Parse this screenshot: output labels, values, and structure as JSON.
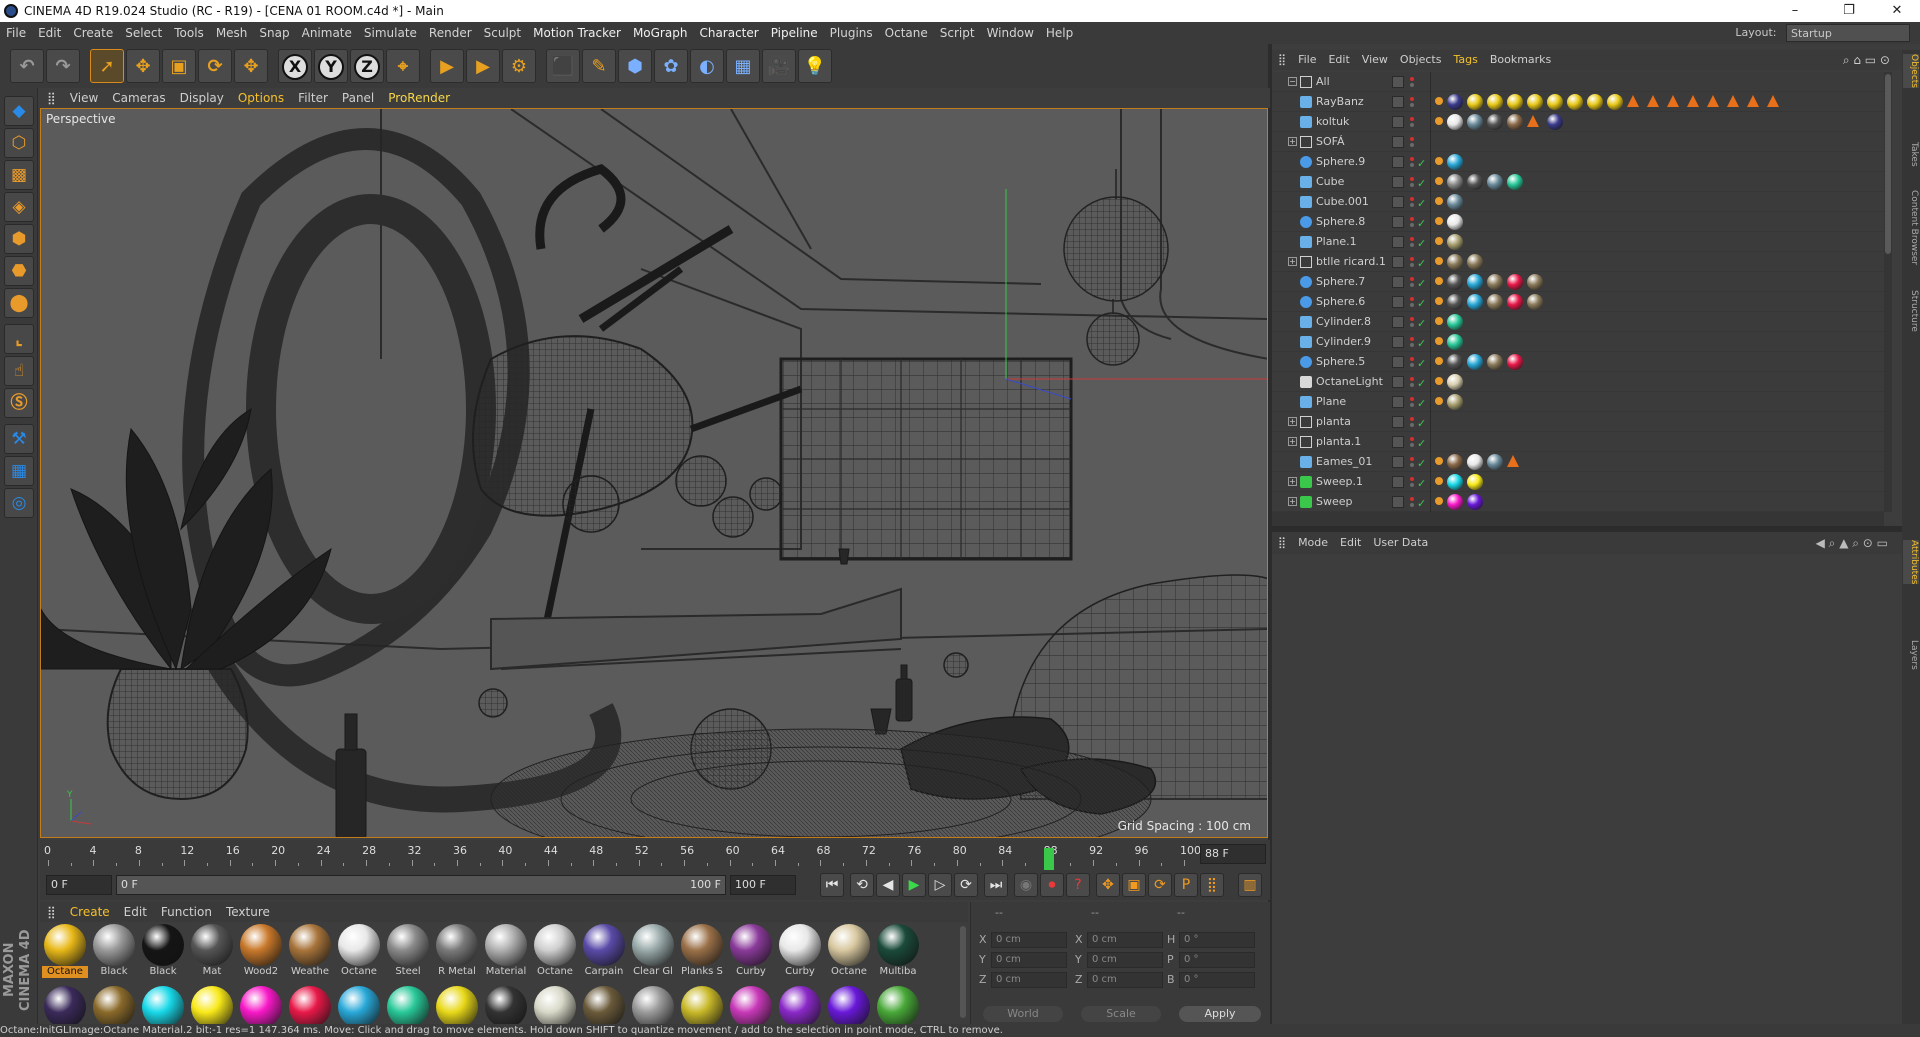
{
  "window": {
    "title": "CINEMA 4D R19.024 Studio (RC - R19) - [CENA 01 ROOM.c4d *] - Main",
    "minimize": "–",
    "restore": "❐",
    "close": "✕"
  },
  "menubar": {
    "items": [
      "File",
      "Edit",
      "Create",
      "Select",
      "Tools",
      "Mesh",
      "Snap",
      "Animate",
      "Simulate",
      "Render",
      "Sculpt",
      "Motion Tracker",
      "MoGraph",
      "Character",
      "Pipeline",
      "Plugins",
      "Octane",
      "Script",
      "Window",
      "Help"
    ],
    "layout_label": "Layout:",
    "layout_value": "Startup"
  },
  "toolbar": {
    "buttons": [
      {
        "name": "undo",
        "glyph": "↶"
      },
      {
        "name": "redo",
        "glyph": "↷"
      },
      {
        "name": "live-select",
        "glyph": "➚"
      },
      {
        "name": "move",
        "glyph": "✥"
      },
      {
        "name": "scale",
        "glyph": "▣"
      },
      {
        "name": "rotate",
        "glyph": "⟳"
      },
      {
        "name": "recent-tool",
        "glyph": "✥"
      },
      {
        "name": "x-axis",
        "glyph": "X"
      },
      {
        "name": "y-axis",
        "glyph": "Y"
      },
      {
        "name": "z-axis",
        "glyph": "Z"
      },
      {
        "name": "coordinate-system",
        "glyph": "⌖"
      },
      {
        "name": "render-view",
        "glyph": "▶"
      },
      {
        "name": "render-picture-viewer",
        "glyph": "▶"
      },
      {
        "name": "edit-render-settings",
        "glyph": "⚙"
      },
      {
        "name": "cube",
        "glyph": "⬛"
      },
      {
        "name": "pen",
        "glyph": "✎"
      },
      {
        "name": "subdivision",
        "glyph": "⬢"
      },
      {
        "name": "cloner",
        "glyph": "✿"
      },
      {
        "name": "deformer",
        "glyph": "◐"
      },
      {
        "name": "floor",
        "glyph": "▦"
      },
      {
        "name": "camera",
        "glyph": "🎥"
      },
      {
        "name": "light",
        "glyph": "💡"
      }
    ]
  },
  "lefttools": {
    "buttons": [
      "make-editable",
      "model-mode",
      "texture-mode",
      "workplane",
      "points-mode",
      "edges-mode",
      "polygons-mode",
      "axis-mode",
      "tweak-mode",
      "snapping",
      "enable-axis",
      "viewport-solo",
      "solo-off"
    ]
  },
  "viewport": {
    "menu": [
      "View",
      "Cameras",
      "Display",
      "Options",
      "Filter",
      "Panel",
      "ProRender"
    ],
    "camera_label": "Perspective",
    "grid_spacing": "Grid Spacing : 100 cm",
    "axis_y": "Y",
    "axis_x": "X",
    "axis_z": "Z"
  },
  "timeline": {
    "ticks": [
      "0",
      "4",
      "8",
      "12",
      "16",
      "20",
      "24",
      "28",
      "32",
      "36",
      "40",
      "44",
      "48",
      "52",
      "56",
      "60",
      "64",
      "68",
      "72",
      "76",
      "80",
      "84",
      "88",
      "92",
      "96",
      "100"
    ],
    "current_frame": "88",
    "current_frame_field": "88 F",
    "start_field": "0 F",
    "range_start": "0 F",
    "range_end": "100 F",
    "end_field": "100 F"
  },
  "materials": {
    "menu": [
      "Create",
      "Edit",
      "Function",
      "Texture"
    ],
    "row1": [
      {
        "name": "Octane",
        "color": "#e8b818"
      },
      {
        "name": "Black",
        "color": "#9a9a9a"
      },
      {
        "name": "Black",
        "color": "#151515"
      },
      {
        "name": "Mat",
        "color": "#555555"
      },
      {
        "name": "Wood2",
        "color": "#c8782a"
      },
      {
        "name": "Weathe",
        "color": "#a8743a"
      },
      {
        "name": "Octane",
        "color": "#e8e8e8"
      },
      {
        "name": "Steel",
        "color": "#8a8a8a"
      },
      {
        "name": "R Metal",
        "color": "#7a7a7a"
      },
      {
        "name": "Material",
        "color": "#b0b0b0"
      },
      {
        "name": "Octane",
        "color": "#cfcfcf"
      },
      {
        "name": "Carpain",
        "color": "#5a4aa8"
      },
      {
        "name": "Clear Gl",
        "color": "#9aaaaa"
      },
      {
        "name": "Planks S",
        "color": "#9a7048"
      },
      {
        "name": "Curby",
        "color": "#8a3a9a"
      },
      {
        "name": "Curby",
        "color": "#e8e8e8"
      },
      {
        "name": "Octane",
        "color": "#d8c8a0"
      },
      {
        "name": "Multiba",
        "color": "#1a4a3a"
      }
    ],
    "row2": [
      "#3a2a5a",
      "#8a6a2a",
      "#18d8e8",
      "#f8e818",
      "#f818c8",
      "#e81848",
      "#28a8d8",
      "#28c898",
      "#e8d818",
      "#333333",
      "#d8d8c8",
      "#6a5a3a",
      "#9a9a9a",
      "#c8b828",
      "#c838b8",
      "#8a28c8",
      "#6818d8",
      "#48a838"
    ]
  },
  "coords": {
    "header": [
      "--",
      "--",
      "--"
    ],
    "pos_labels": [
      "X",
      "Y",
      "Z"
    ],
    "pos_values": [
      "0 cm",
      "0 cm",
      "0 cm"
    ],
    "size_labels": [
      "X",
      "Y",
      "Z"
    ],
    "size_values": [
      "0 cm",
      "0 cm",
      "0 cm"
    ],
    "rot_labels": [
      "H",
      "P",
      "B"
    ],
    "rot_values": [
      "0 °",
      "0 °",
      "0 °"
    ],
    "mode": "World",
    "size_mode": "Scale",
    "apply": "Apply"
  },
  "objects": {
    "menu": [
      "File",
      "Edit",
      "View",
      "Objects",
      "Tags",
      "Bookmarks"
    ],
    "rows": [
      {
        "name": "All",
        "icon": "null",
        "expand": "−",
        "tags": []
      },
      {
        "name": "RayBanz",
        "icon": "polygon",
        "tags": [
          "#3a3a8a",
          "#e8c818",
          "#e8c818",
          "#e8c818",
          "#e8c818",
          "#e8c818",
          "#e8c818",
          "#e8c818",
          "#e8c818",
          "tri",
          "tri",
          "tri",
          "tri",
          "tri",
          "tri",
          "tri",
          "tri"
        ]
      },
      {
        "name": "koltuk",
        "icon": "polygon",
        "tags": [
          "#e8e8e8",
          "#6a8a9a",
          "#555555",
          "#8a6a4a",
          "tri",
          "#3a3a8a"
        ]
      },
      {
        "name": "SOFÁ",
        "icon": "null",
        "expand": "+",
        "tags": []
      },
      {
        "name": "Sphere.9",
        "icon": "sphere",
        "tags": [
          "#28a8d8"
        ]
      },
      {
        "name": "Cube",
        "icon": "polygon",
        "tags": [
          "#8a8a8a",
          "#555555",
          "#6a8a9a",
          "#28c898"
        ]
      },
      {
        "name": "Cube.001",
        "icon": "polygon",
        "tags": [
          "#6a8a9a"
        ]
      },
      {
        "name": "Sphere.8",
        "icon": "sphere",
        "tags": [
          "#e8e8e8"
        ]
      },
      {
        "name": "Plane.1",
        "icon": "plane",
        "tags": [
          "#a8a070"
        ]
      },
      {
        "name": "btlle ricard.1",
        "icon": "null",
        "expand": "+",
        "tags": [
          "#8a7a5a",
          "#8a7a5a"
        ]
      },
      {
        "name": "Sphere.7",
        "icon": "sphere",
        "tags": [
          "#555555",
          "#28a8d8",
          "#8a7a5a",
          "#e81848",
          "#8a7a5a"
        ]
      },
      {
        "name": "Sphere.6",
        "icon": "sphere",
        "tags": [
          "#555555",
          "#28a8d8",
          "#8a7a5a",
          "#e81848",
          "#8a7a5a"
        ]
      },
      {
        "name": "Cylinder.8",
        "icon": "cylinder",
        "tags": [
          "#28c898"
        ]
      },
      {
        "name": "Cylinder.9",
        "icon": "cylinder",
        "tags": [
          "#28c898"
        ]
      },
      {
        "name": "Sphere.5",
        "icon": "sphere",
        "tags": [
          "#555555",
          "#28a8d8",
          "#8a7a5a",
          "#e81848"
        ]
      },
      {
        "name": "OctaneLight",
        "icon": "light",
        "tags": [
          "#d8d0b0"
        ]
      },
      {
        "name": "Plane",
        "icon": "plane",
        "tags": [
          "#a8a070"
        ]
      },
      {
        "name": "planta",
        "icon": "null",
        "expand": "+",
        "tags": []
      },
      {
        "name": "planta.1",
        "icon": "null",
        "expand": "+",
        "tags": []
      },
      {
        "name": "Eames_01",
        "icon": "polygon",
        "tags": [
          "#8a6a4a",
          "#e8e8e8",
          "#6a8a9a",
          "tri"
        ]
      },
      {
        "name": "Sweep.1",
        "icon": "sweep",
        "expand": "+",
        "tags": [
          "#18d8e8",
          "#f8e818"
        ]
      },
      {
        "name": "Sweep",
        "icon": "sweep",
        "expand": "+",
        "tags": [
          "#f818c8",
          "#6818d8"
        ]
      }
    ]
  },
  "attributes": {
    "menu": [
      "Mode",
      "Edit",
      "User Data"
    ]
  },
  "righttabs": [
    "Objects",
    "Takes",
    "Content Browser",
    "Structure",
    "Attributes",
    "Layers"
  ],
  "statusbar": {
    "text": "Octane:InitGLImage:Octane Material.2  bit:-1 res=1  147.364 ms.     Move: Click and drag to move elements. Hold down SHIFT to quantize movement / add to the selection in point mode, CTRL to remove."
  },
  "branding": {
    "text": "MAXON CINEMA 4D"
  }
}
